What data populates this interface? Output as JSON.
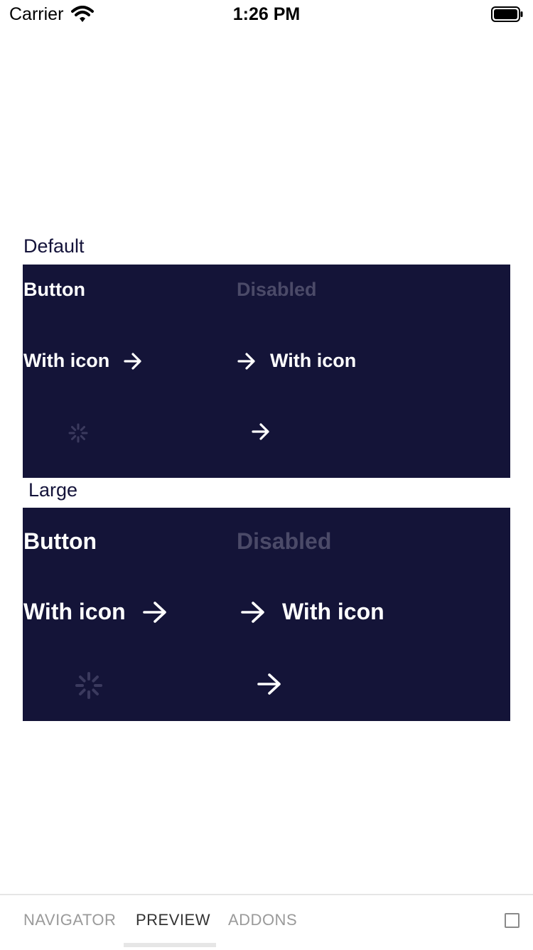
{
  "status_bar": {
    "carrier": "Carrier",
    "time": "1:26 PM"
  },
  "sections": {
    "default": {
      "label": "Default",
      "button": "Button",
      "disabled": "Disabled",
      "with_icon_trailing": "With icon",
      "with_icon_leading": "With icon"
    },
    "large": {
      "label": "Large",
      "button": "Button",
      "disabled": "Disabled",
      "with_icon_trailing": "With icon",
      "with_icon_leading": "With icon"
    }
  },
  "tabs": [
    {
      "label": "NAVIGATOR",
      "active": false
    },
    {
      "label": "PREVIEW",
      "active": true
    },
    {
      "label": "ADDONS",
      "active": false
    }
  ],
  "colors": {
    "panel_bg": "#141438",
    "text_on_panel": "#ffffff",
    "disabled_text": "#4b4a68",
    "label_text": "#14133a",
    "tab_inactive": "#9a9a9a",
    "tab_active": "#333333"
  },
  "icons": [
    "wifi-icon",
    "battery-icon",
    "arrow-right-icon",
    "spinner-icon",
    "fullscreen-toggle-icon"
  ]
}
